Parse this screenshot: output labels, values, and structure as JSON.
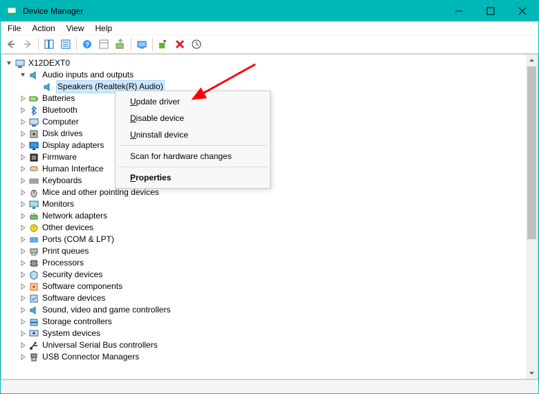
{
  "titlebar": {
    "title": "Device Manager"
  },
  "menubar": {
    "items": [
      "File",
      "Action",
      "View",
      "Help"
    ]
  },
  "tree": {
    "root": {
      "label": "X12DEXT0",
      "icon": "computer-icon",
      "expanded": true
    },
    "audio": {
      "label": "Audio inputs and outputs",
      "icon": "speaker-icon",
      "expanded": true,
      "child": {
        "label": "Speakers (Realtek(R) Audio)",
        "icon": "speaker-icon"
      }
    },
    "items": [
      {
        "label": "Batteries",
        "icon": "battery-icon"
      },
      {
        "label": "Bluetooth",
        "icon": "bluetooth-icon"
      },
      {
        "label": "Computer",
        "icon": "computer-icon"
      },
      {
        "label": "Disk drives",
        "icon": "disk-icon"
      },
      {
        "label": "Display adapters",
        "icon": "display-icon"
      },
      {
        "label": "Firmware",
        "icon": "firmware-icon"
      },
      {
        "label": "Human Interface",
        "icon": "hid-icon"
      },
      {
        "label": "Keyboards",
        "icon": "keyboard-icon"
      },
      {
        "label": "Mice and other pointing devices",
        "icon": "mouse-icon"
      },
      {
        "label": "Monitors",
        "icon": "monitor-icon"
      },
      {
        "label": "Network adapters",
        "icon": "network-icon"
      },
      {
        "label": "Other devices",
        "icon": "other-icon"
      },
      {
        "label": "Ports (COM & LPT)",
        "icon": "port-icon"
      },
      {
        "label": "Print queues",
        "icon": "printer-icon"
      },
      {
        "label": "Processors",
        "icon": "cpu-icon"
      },
      {
        "label": "Security devices",
        "icon": "security-icon"
      },
      {
        "label": "Software components",
        "icon": "software-icon"
      },
      {
        "label": "Software devices",
        "icon": "software-device-icon"
      },
      {
        "label": "Sound, video and game controllers",
        "icon": "sound-icon"
      },
      {
        "label": "Storage controllers",
        "icon": "storage-icon"
      },
      {
        "label": "System devices",
        "icon": "system-icon"
      },
      {
        "label": "Universal Serial Bus controllers",
        "icon": "usb-icon"
      },
      {
        "label": "USB Connector Managers",
        "icon": "usb-connector-icon"
      }
    ]
  },
  "contextmenu": {
    "update": "pdate driver",
    "update_u": "U",
    "disable": "isable device",
    "disable_u": "D",
    "uninstall": "ninstall device",
    "uninstall_u": "U",
    "scan": "Scan for hardware changes",
    "properties": "roperties",
    "properties_u": "P"
  },
  "toolbar_icons": [
    "back-icon",
    "forward-icon",
    "show-hide-tree-icon",
    "properties-icon",
    "help-icon",
    "detail-icon",
    "print-icon",
    "monitor-icon",
    "scan-hardware-icon",
    "delete-icon",
    "action-icon"
  ],
  "colors": {
    "titlebar": "#00b7b7",
    "selection": "#cde8ff",
    "arrow": "#ff0000"
  }
}
